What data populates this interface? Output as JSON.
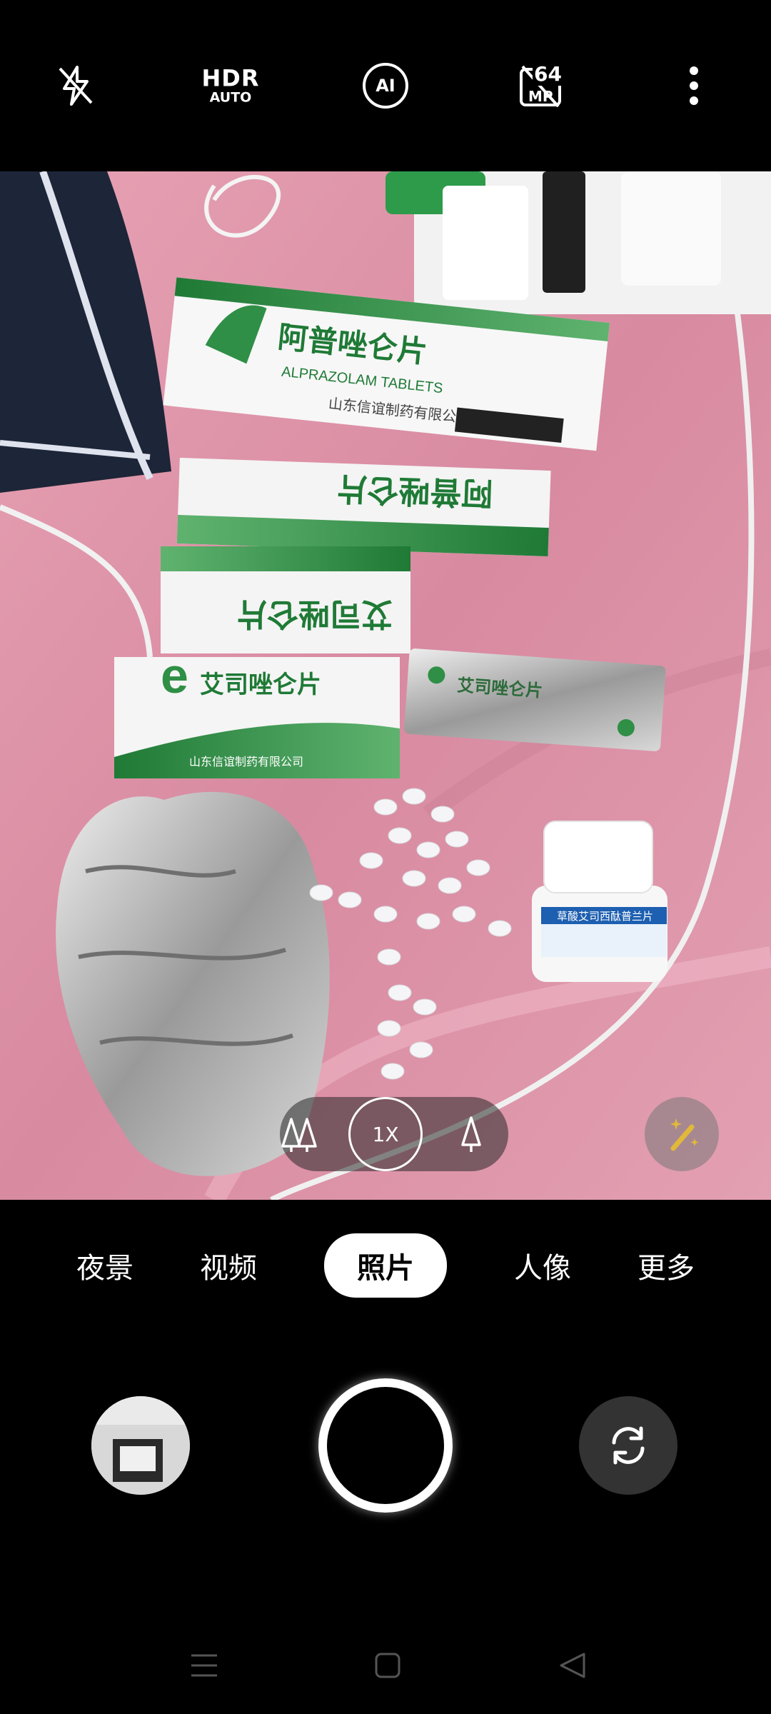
{
  "top_bar": {
    "flash_icon": "flash-off-icon",
    "hdr_label": "HDR",
    "hdr_sub_label": "AUTO",
    "ai_label": "AI",
    "resolution_label": "64",
    "resolution_sub_label": "MP",
    "more_icon": "more-vertical-icon"
  },
  "zoom": {
    "wide_icon": "trees-icon",
    "current": "1X",
    "tele_icon": "tree-icon"
  },
  "magic_icon": "magic-wand-icon",
  "modes": [
    {
      "label": "夜景"
    },
    {
      "label": "视频"
    },
    {
      "label": "照片",
      "active": true
    },
    {
      "label": "人像"
    },
    {
      "label": "更多"
    }
  ],
  "boxes": [
    {
      "title": "阿普唑仑片",
      "sub": "ALPRAZOLAM TABLETS",
      "maker": "山东信谊制药有限公司"
    },
    {
      "title": "阿普唑仑片"
    },
    {
      "title": "艾司唑仑片"
    },
    {
      "title": "艾司唑仑片",
      "maker": "山东信谊制药有限公司"
    }
  ],
  "blister_label": "艾司唑仑片",
  "bottle_label": "草酸艾司西酞普兰片",
  "colors": {
    "accent": "#ffffff",
    "box_green": "#2f8f46",
    "bed_pink": "#d98aa0"
  }
}
